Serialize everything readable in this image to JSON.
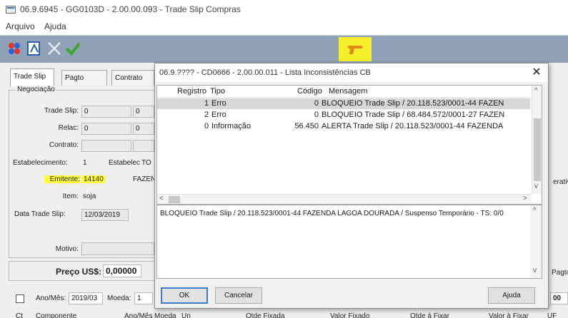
{
  "window": {
    "title": "06.9.6945 - GG0103D - 2.00.00.093 - Trade Slip Compras"
  },
  "menu": [
    "Arquivo",
    "Ajuda"
  ],
  "toolbar": {
    "icons": [
      "users-icon",
      "document-edit-icon",
      "delete-icon",
      "check-icon"
    ],
    "status_icon": "gun-icon"
  },
  "tabs": [
    "Trade Slip",
    "Pagto",
    "Contrato"
  ],
  "form": {
    "group_label": "Negociação",
    "trade_slip": {
      "label": "Trade Slip:",
      "value": "0",
      "value2": "0"
    },
    "relac": {
      "label": "Relac:",
      "value": "0",
      "value2": "0"
    },
    "contrato": {
      "label": "Contrato:"
    },
    "estabelecimento": {
      "label": "Estabelecimento:",
      "value": "1",
      "label2": "Estabelec",
      "value2": "TO"
    },
    "emitente": {
      "label": "Emitente:",
      "value": "14140",
      "value2": "FAZEN"
    },
    "item": {
      "label": "Item:",
      "value": "soja"
    },
    "data_trade_slip": {
      "label": "Data Trade Slip:",
      "value": "12/03/2019"
    },
    "motivo": {
      "label": "Motivo:"
    },
    "preco": {
      "label": "Preço US$:",
      "value": "0,00000"
    },
    "ano_mes": {
      "label": "Ano/Mês:",
      "value": "2019/03"
    },
    "moeda": {
      "label": "Moeda:",
      "value": "1"
    },
    "right_fragments": {
      "erativ": "erativ",
      "pagto": "Pagto",
      "oo": "00"
    },
    "bottom_headers": [
      "Ct",
      "Componente",
      "Ano/Mês",
      "Moeda",
      "Un",
      "Qtde Fixada",
      "Valor Fixado",
      "Qtde à Fixar",
      "Valor à Fixar",
      "UF"
    ]
  },
  "dialog": {
    "title": "06.9.???? - CD0666 - 2.00.00.011 - Lista Inconsistências CB",
    "columns": [
      "Registro",
      "Tipo",
      "Código",
      "Mensagem"
    ],
    "rows": [
      {
        "registro": "1",
        "tipo": "Erro",
        "codigo": "0",
        "mensagem": "BLOQUEIO Trade Slip / 20.118.523/0001-44 FAZEN"
      },
      {
        "registro": "2",
        "tipo": "Erro",
        "codigo": "0",
        "mensagem": "BLOQUEIO Trade Slip / 68.484.572/0001-27 FAZEN"
      },
      {
        "registro": "0",
        "tipo": "Informação",
        "codigo": "56.450",
        "mensagem": "ALERTA Trade Slip / 20.118.523/0001-44 FAZENDA"
      }
    ],
    "detail": "BLOQUEIO Trade Slip / 20.118.523/0001-44 FAZENDA LAGOA DOURADA / Suspenso Temporário - TS: 0/0",
    "buttons": {
      "ok": "OK",
      "cancel": "Cancelar",
      "help": "Ajuda"
    }
  }
}
